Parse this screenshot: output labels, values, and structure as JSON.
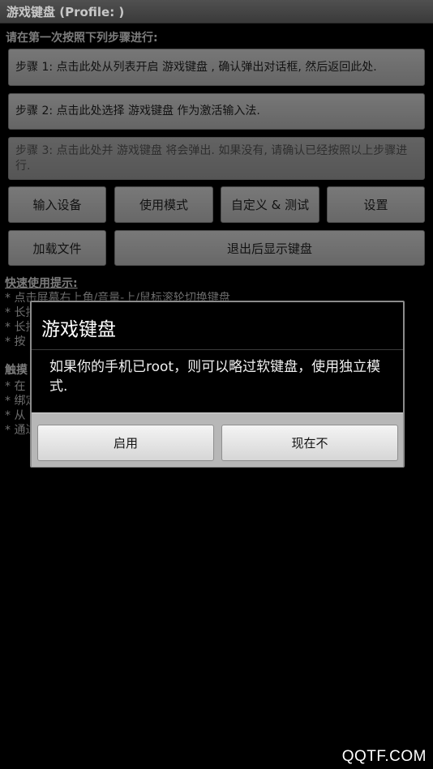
{
  "titlebar": {
    "title": "游戏键盘 (Profile: )"
  },
  "main": {
    "instruction": "请在第一次按照下列步骤进行:",
    "steps": [
      {
        "label": "步骤 1: 点击此处从列表开启 游戏键盘 , 确认弹出对话框, 然后返回此处."
      },
      {
        "label": "步骤 2: 点击此处选择 游戏键盘 作为激活输入法."
      },
      {
        "label": "步骤 3: 点击此处并 游戏键盘 将会弹出. 如果没有, 请确认已经按照以上步骤进行."
      }
    ],
    "buttons": {
      "input_device": "输入设备",
      "usage_mode": "使用模式",
      "custom_test": "自定义 & 测试",
      "settings": "设置",
      "load_file": "加载文件",
      "exit_show_keyboard": "退出后显示键盘"
    },
    "tips_title": "快速使用提示:",
    "tips": [
      "* 点击屏幕右上角/音量-上/鼠标滚轮切换键盘",
      "* 长按",
      "* 长按",
      "* 按"
    ],
    "section_title": "触摸",
    "section_items": [
      "* 在",
      "* 绑定",
      "* 从",
      "* 通过"
    ]
  },
  "dialog": {
    "title": "游戏键盘",
    "message": "如果你的手机已root，则可以略过软键盘，使用独立模式.",
    "enable_label": "启用",
    "not_now_label": "现在不"
  },
  "watermark": "QQTF.COM"
}
